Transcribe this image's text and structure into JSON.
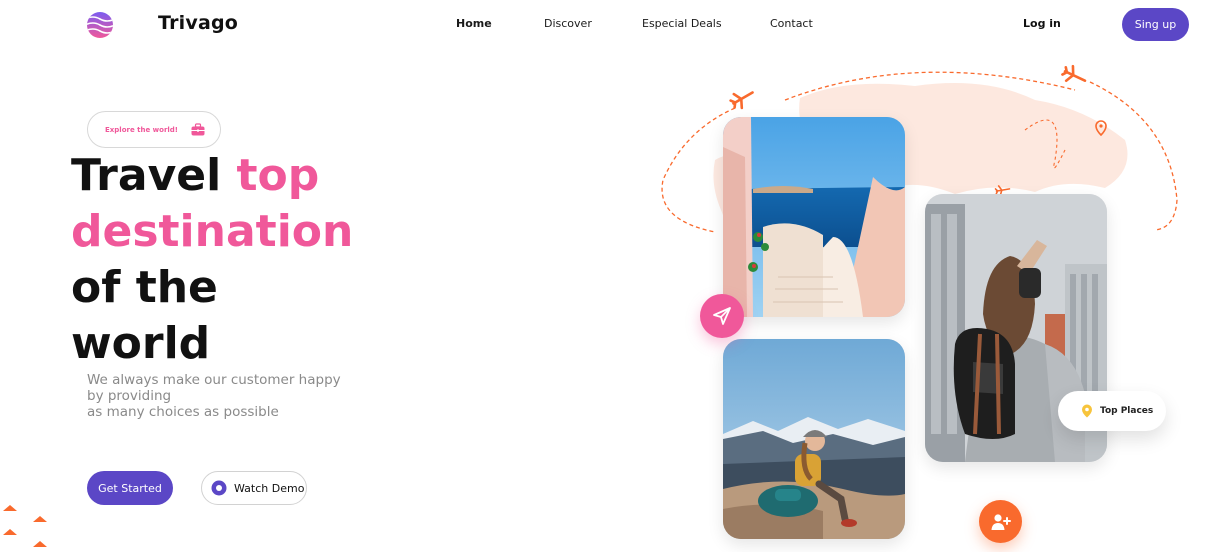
{
  "brand": {
    "name": "Trivago",
    "logo_icon": "striped-circle-logo"
  },
  "nav": {
    "links": [
      {
        "label": "Home",
        "active": true
      },
      {
        "label": "Discover",
        "active": false
      },
      {
        "label": "Especial Deals",
        "active": false
      },
      {
        "label": "Contact",
        "active": false
      }
    ],
    "login_label": "Log in",
    "signup_label": "Sing up"
  },
  "hero": {
    "badge_label": "Explore the world!",
    "badge_icon": "briefcase-icon",
    "headline": {
      "line1_plain": "Travel ",
      "line1_accent": "top",
      "line2_accent": "destination",
      "line3": "of the",
      "line4": "world"
    },
    "subtext_lines": [
      "We always make our customer happy",
      "by providing",
      "as many choices as possible"
    ],
    "cta_primary": "Get Started",
    "cta_secondary": "Watch Demo"
  },
  "gallery": {
    "photos": [
      "santorini-stairs-photo",
      "mountain-hiker-photo",
      "city-traveler-photo"
    ],
    "badge_label": "Top Places",
    "badge_icon": "map-pin-icon",
    "send_icon": "paper-plane-icon",
    "add_user_icon": "add-user-icon"
  },
  "colors": {
    "accent_pink": "#f0589a",
    "accent_purple": "#5b47c6",
    "accent_orange": "#f96a2d",
    "text_dark": "#111111",
    "text_muted": "#8a8a8a"
  }
}
